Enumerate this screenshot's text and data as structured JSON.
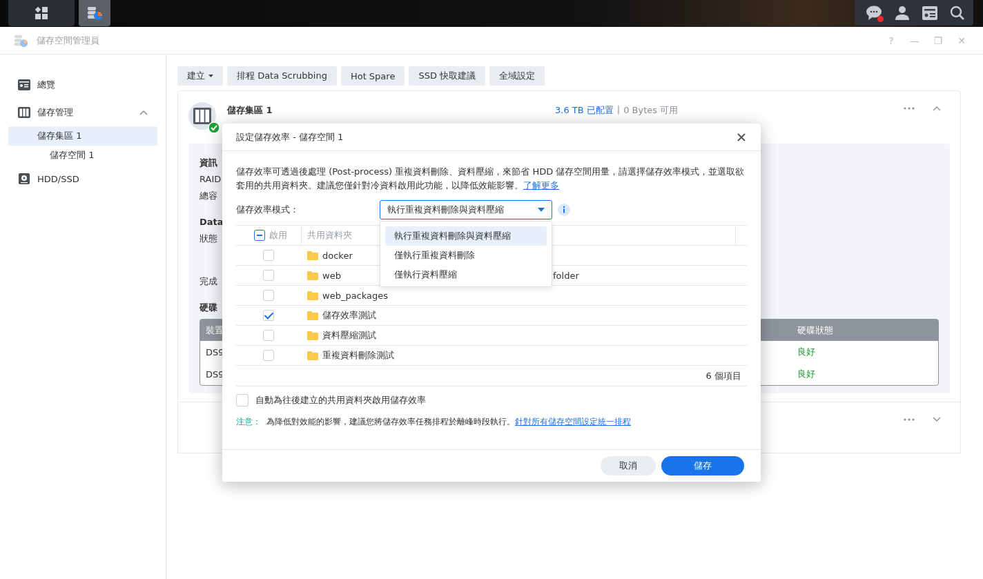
{
  "taskbar": {
    "apps": [
      {
        "kind": "grid",
        "selected": false
      },
      {
        "kind": "storage",
        "selected": true
      }
    ],
    "tray": [
      {
        "kind": "chat",
        "badge": true
      },
      {
        "kind": "user"
      },
      {
        "kind": "widget"
      },
      {
        "kind": "search"
      }
    ]
  },
  "window": {
    "title": "儲存空間管理員",
    "controls": [
      "?",
      "—",
      "❐",
      "✕"
    ]
  },
  "sidebar": {
    "items": [
      {
        "label": "總覽",
        "kind": "overview",
        "selected": false
      },
      {
        "label": "儲存管理",
        "kind": "storage",
        "expanded": true,
        "selected": false,
        "children": [
          {
            "label": "儲存集區 1",
            "selected": true,
            "children": [
              {
                "label": "儲存空間 1",
                "selected": false
              }
            ]
          }
        ]
      },
      {
        "label": "HDD/SSD",
        "kind": "disk",
        "selected": false
      }
    ]
  },
  "toolbar": [
    {
      "label": "建立",
      "has_menu": true
    },
    {
      "label": "排程 Data Scrubbing",
      "has_menu": false
    },
    {
      "label": "Hot Spare",
      "has_menu": false
    },
    {
      "label": "SSD 快取建議",
      "has_menu": false
    },
    {
      "label": "全域設定",
      "has_menu": false
    }
  ],
  "pool": {
    "title": "儲存集區 1",
    "healthy": true,
    "expanded": true,
    "allocated": "3.6 TB 已配置",
    "separator": "|",
    "available": "0 Bytes 可用",
    "info": [
      {
        "text": "資訊",
        "kind": "heading"
      },
      {
        "text": "RAID",
        "kind": "line"
      },
      {
        "text": "總容",
        "kind": "line"
      },
      {
        "text": "Data",
        "kind": "heading"
      },
      {
        "text": "狀態",
        "kind": "line"
      },
      {
        "text": "完成",
        "kind": "gap"
      },
      {
        "text": "硬碟",
        "kind": "heading"
      }
    ],
    "disks": {
      "columns": [
        "裝置",
        "硬碟狀態"
      ],
      "rows": [
        {
          "device": "DS9",
          "status": "良好"
        },
        {
          "device": "DS9",
          "status": "良好"
        }
      ]
    }
  },
  "second_card": {
    "expanded": false
  },
  "dialog": {
    "title": "設定儲存效率 - 儲存空間 1",
    "description": "儲存效率可透過後處理 (Post-process) 重複資料刪除、資料壓縮，來節省 HDD 儲存空間用量，請選擇儲存效率模式，並選取欲套用的共用資料夾。建議您僅針對冷資料啟用此功能，以降低效能影響。",
    "learn_more": "了解更多",
    "mode_label": "儲存效率模式：",
    "mode_value": "執行重複資料刪除與資料壓縮",
    "mode_options": [
      {
        "label": "執行重複資料刪除與資料壓縮",
        "selected": true
      },
      {
        "label": "僅執行重複資料刪除",
        "selected": false
      },
      {
        "label": "僅執行資料壓縮",
        "selected": false
      }
    ],
    "table": {
      "columns": [
        "啟用",
        "共用資料夾"
      ],
      "header_partial": true,
      "rows": [
        {
          "name": "docker",
          "checked": false
        },
        {
          "name": "web",
          "checked": false,
          "column_3": "folder"
        },
        {
          "name": "web_packages",
          "checked": false
        },
        {
          "name": "儲存效率測試",
          "checked": true
        },
        {
          "name": "資料壓縮測試",
          "checked": false
        },
        {
          "name": "重複資料刪除測試",
          "checked": false
        }
      ],
      "count": "6 個項目"
    },
    "auto_enable": {
      "label": "自動為往後建立的共用資料夾啟用儲存效率",
      "checked": false
    },
    "note_label": "注意：",
    "note": "為降低對效能的影響，建議您將儲存效率任務排程於離峰時段執行。",
    "note_link": "針對所有儲存空間設定統一排程",
    "buttons": [
      {
        "label": "取消",
        "kind": "secondary"
      },
      {
        "label": "儲存",
        "kind": "primary"
      }
    ]
  }
}
